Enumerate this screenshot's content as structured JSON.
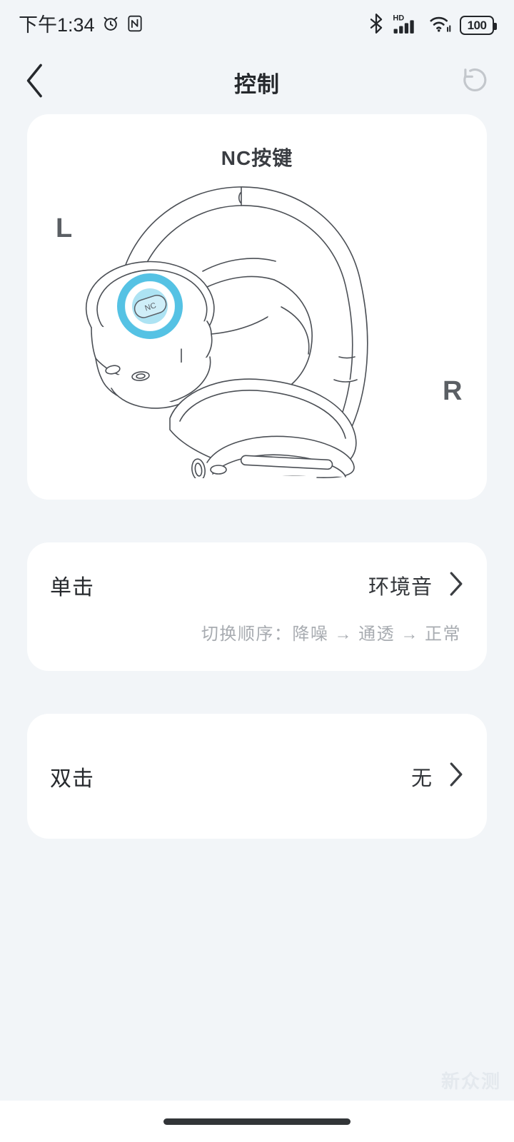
{
  "status_bar": {
    "time": "下午1:34",
    "left_icons": [
      "alarm-clock-icon",
      "nfc-icon"
    ],
    "right_icons": [
      "bluetooth-icon",
      "hd-signal-icon",
      "wifi-icon"
    ],
    "battery_level": "100"
  },
  "header": {
    "back_icon": "chevron-left-icon",
    "title": "控制",
    "reset_icon": "reset-icon"
  },
  "hero": {
    "title": "NC按键",
    "left_label": "L",
    "right_label": "R",
    "button_label": "NC",
    "highlight_color": "#4cbfe3",
    "highlight_inner_color": "#a9e1f2"
  },
  "rows": [
    {
      "label": "单击",
      "value": "环境音",
      "chevron": "chevron-right-icon",
      "sub": "切换顺序：降噪 → 通透 → 正常"
    },
    {
      "label": "双击",
      "value": "无",
      "chevron": "chevron-right-icon",
      "sub": ""
    }
  ],
  "watermark": "新众测",
  "theme": {
    "background": "#f2f5f8",
    "card": "#ffffff",
    "text_primary": "#26292d",
    "text_secondary": "#a8acb1"
  }
}
